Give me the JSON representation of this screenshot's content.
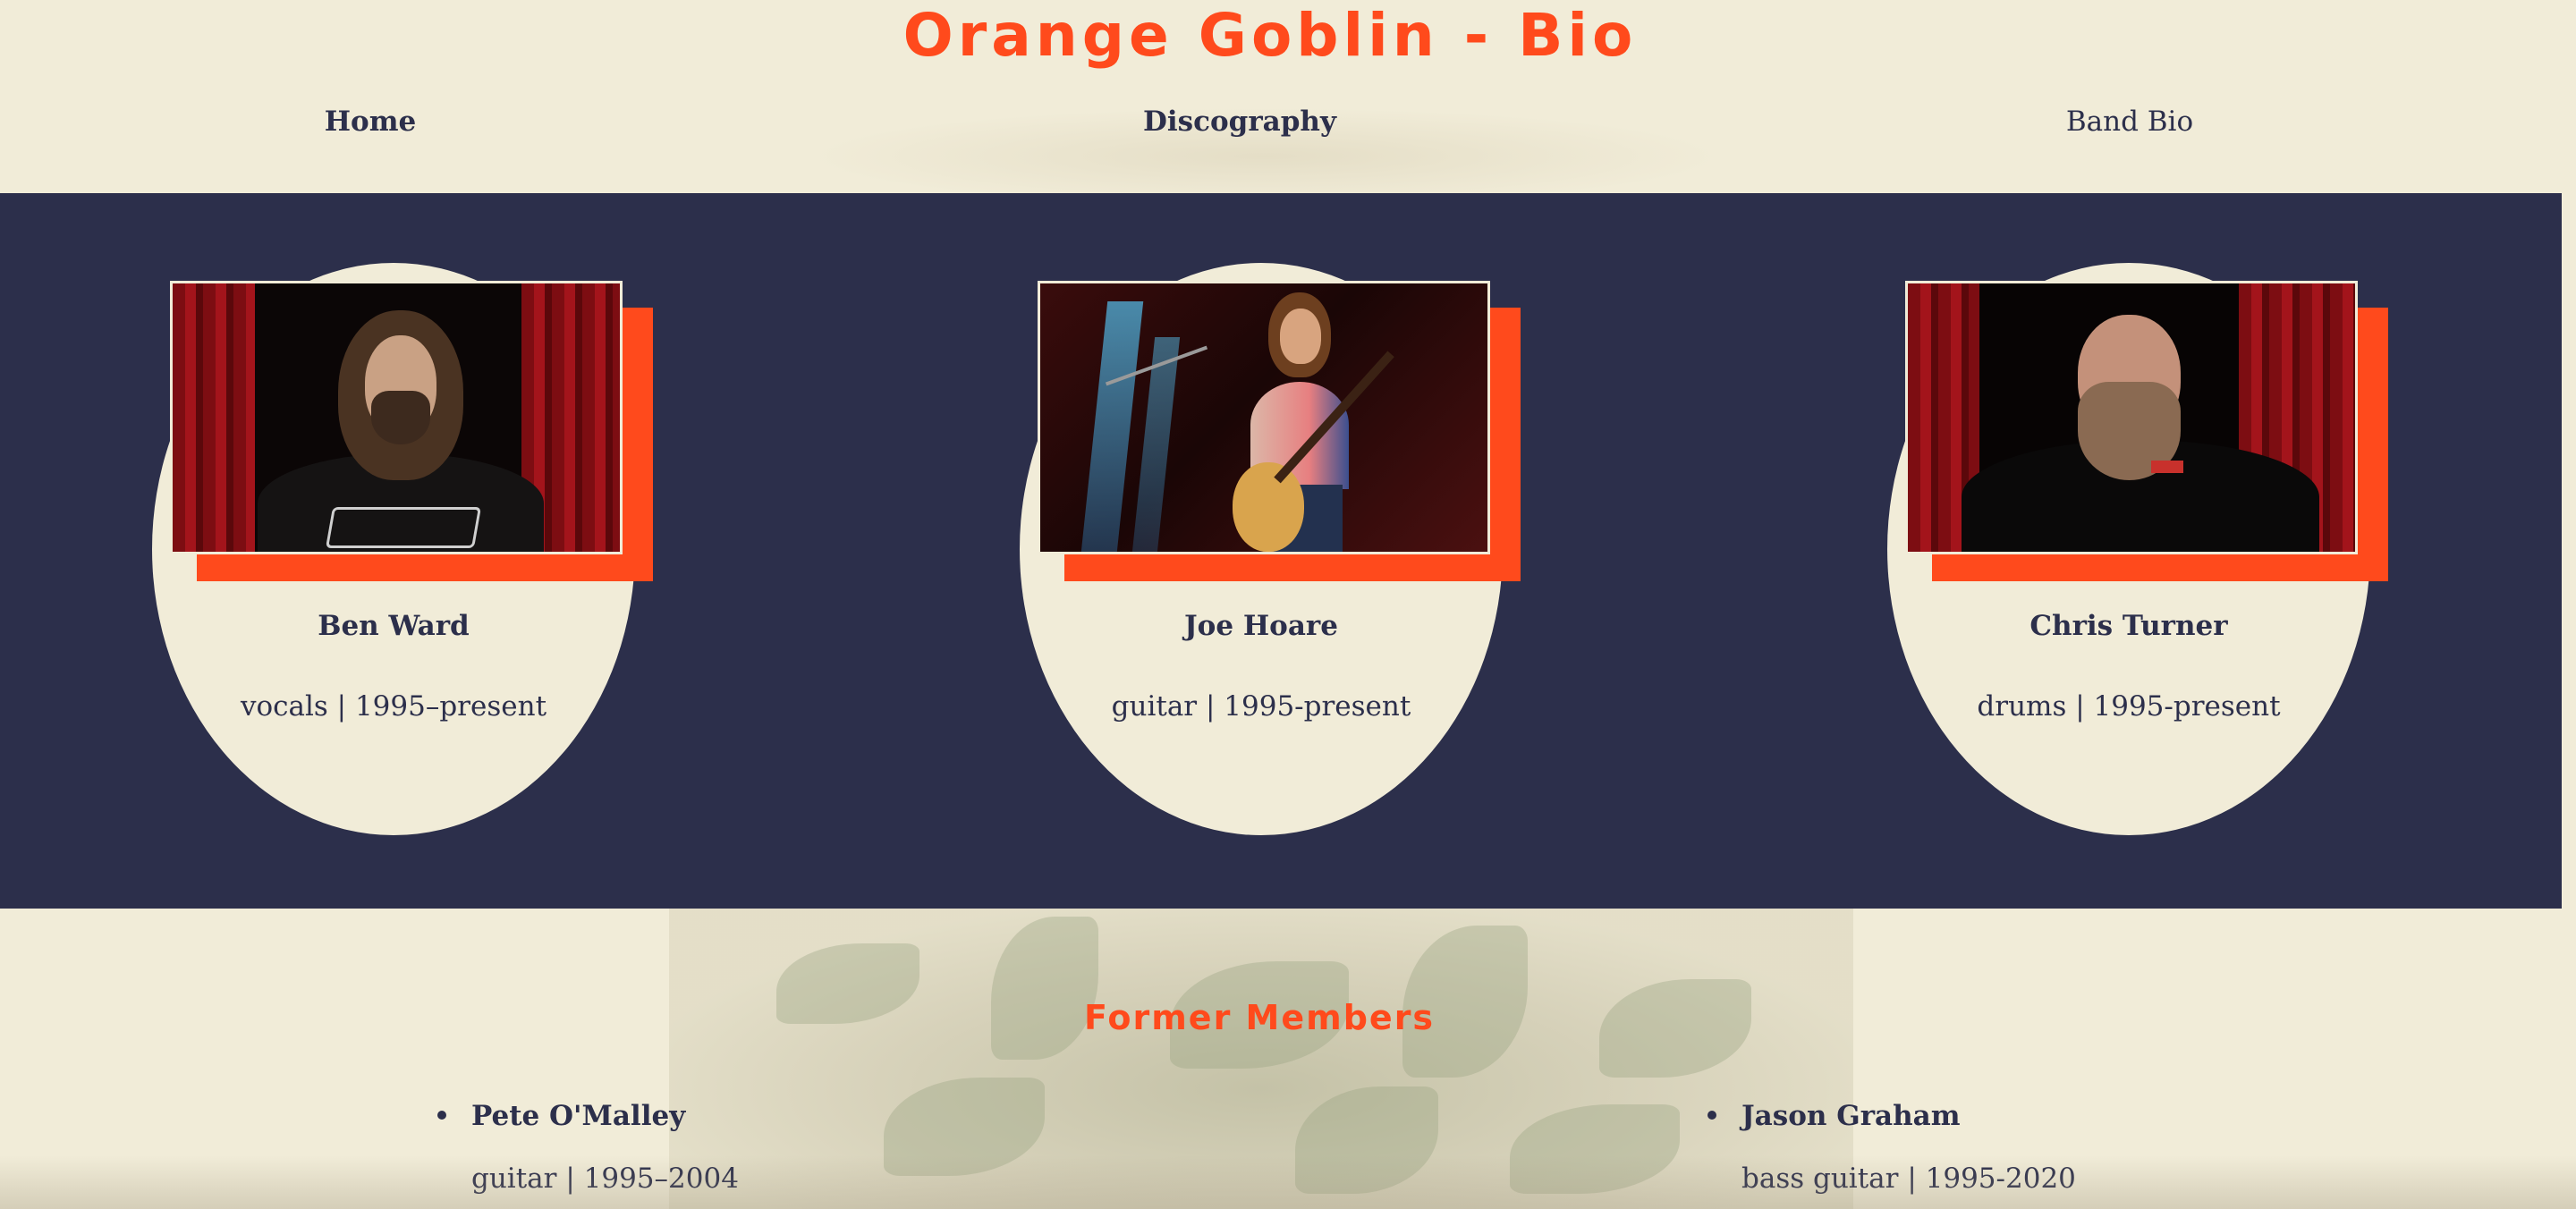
{
  "header": {
    "title": "Orange Goblin - Bio"
  },
  "nav": {
    "items": [
      {
        "label": "Home"
      },
      {
        "label": "Discography"
      },
      {
        "label": "Band Bio"
      }
    ]
  },
  "members": [
    {
      "name": "Ben Ward",
      "role": "vocals | 1995–present"
    },
    {
      "name": "Joe Hoare",
      "role": "guitar | 1995-present"
    },
    {
      "name": "Chris Turner",
      "role": "drums | 1995-present"
    }
  ],
  "former": {
    "title": "Former Members",
    "items": [
      {
        "name": "Pete O'Malley",
        "role": "guitar | 1995–2004"
      },
      {
        "name": "Jason Graham",
        "role": "bass guitar | 1995-2020"
      }
    ]
  },
  "colors": {
    "accent": "#ff4a1c",
    "navy": "#2c2f4b",
    "cream": "#f1ecd8"
  }
}
